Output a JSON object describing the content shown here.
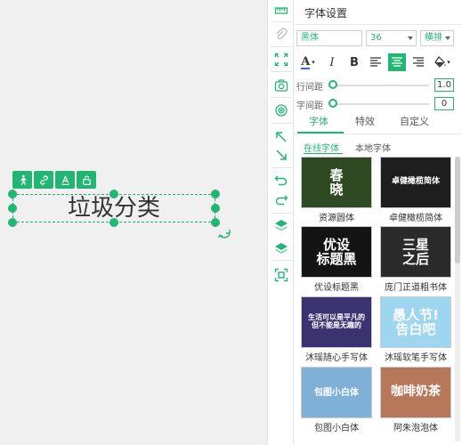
{
  "canvas": {
    "text": "垃圾分类",
    "toolbar_icons": [
      "walk-icon",
      "link-icon",
      "text-a-icon",
      "lock-icon"
    ]
  },
  "vtoolbar": {
    "icons": [
      "ruler-icon",
      "clip-icon",
      "fit-screen-icon",
      "camera-icon",
      "target-icon",
      "arrow-up-left-icon",
      "arrow-down-right-icon",
      "undo-icon",
      "redo-icon",
      "layer-up-icon",
      "layer-down-icon",
      "crop-frame-icon"
    ]
  },
  "panel": {
    "title": "字体设置",
    "font_family": "黑体",
    "font_size": "36",
    "orientation": "横排",
    "format": {
      "color_label": "A",
      "italic_label": "I",
      "bold_label": "B"
    },
    "line_spacing": {
      "label": "行间距",
      "value": "1.0"
    },
    "letter_spacing": {
      "label": "字间距",
      "value": "0"
    },
    "tabs": [
      "字体",
      "特效",
      "自定义"
    ],
    "active_tab": 0,
    "subtabs": [
      "在线字体",
      "本地字体"
    ],
    "active_subtab": 0,
    "fonts": [
      {
        "name": "资源圆体",
        "sample": "春\n晓",
        "bg": "#2e4a22",
        "fg": "#ffffff"
      },
      {
        "name": "卓健橄榄简体",
        "sample": "卓健橄榄简体",
        "bg": "#1e1e1e",
        "fg": "#ffffff"
      },
      {
        "name": "优设标题黑",
        "sample": "优设\n标题黑",
        "bg": "#141414",
        "fg": "#ffffff"
      },
      {
        "name": "庞门正道粗书体",
        "sample": "三星\n之后",
        "bg": "#2a2a2a",
        "fg": "#ffffff"
      },
      {
        "name": "沐瑶随心手写体",
        "sample": "生活可以是平凡的\n但不能是无趣的",
        "bg": "#3b3270",
        "fg": "#ffffff"
      },
      {
        "name": "沐瑶软笔手写体",
        "sample": "愚人节!\n告白吧",
        "bg": "#9fd6ef",
        "fg": "#ffffff"
      },
      {
        "name": "包图小白体",
        "sample": "包图小白体",
        "bg": "#7eb0d8",
        "fg": "#ffffff"
      },
      {
        "name": "阿朱泡泡体",
        "sample": "咖啡奶茶",
        "bg": "#b7775a",
        "fg": "#ffffff"
      }
    ]
  },
  "colors": {
    "accent": "#22b573"
  }
}
